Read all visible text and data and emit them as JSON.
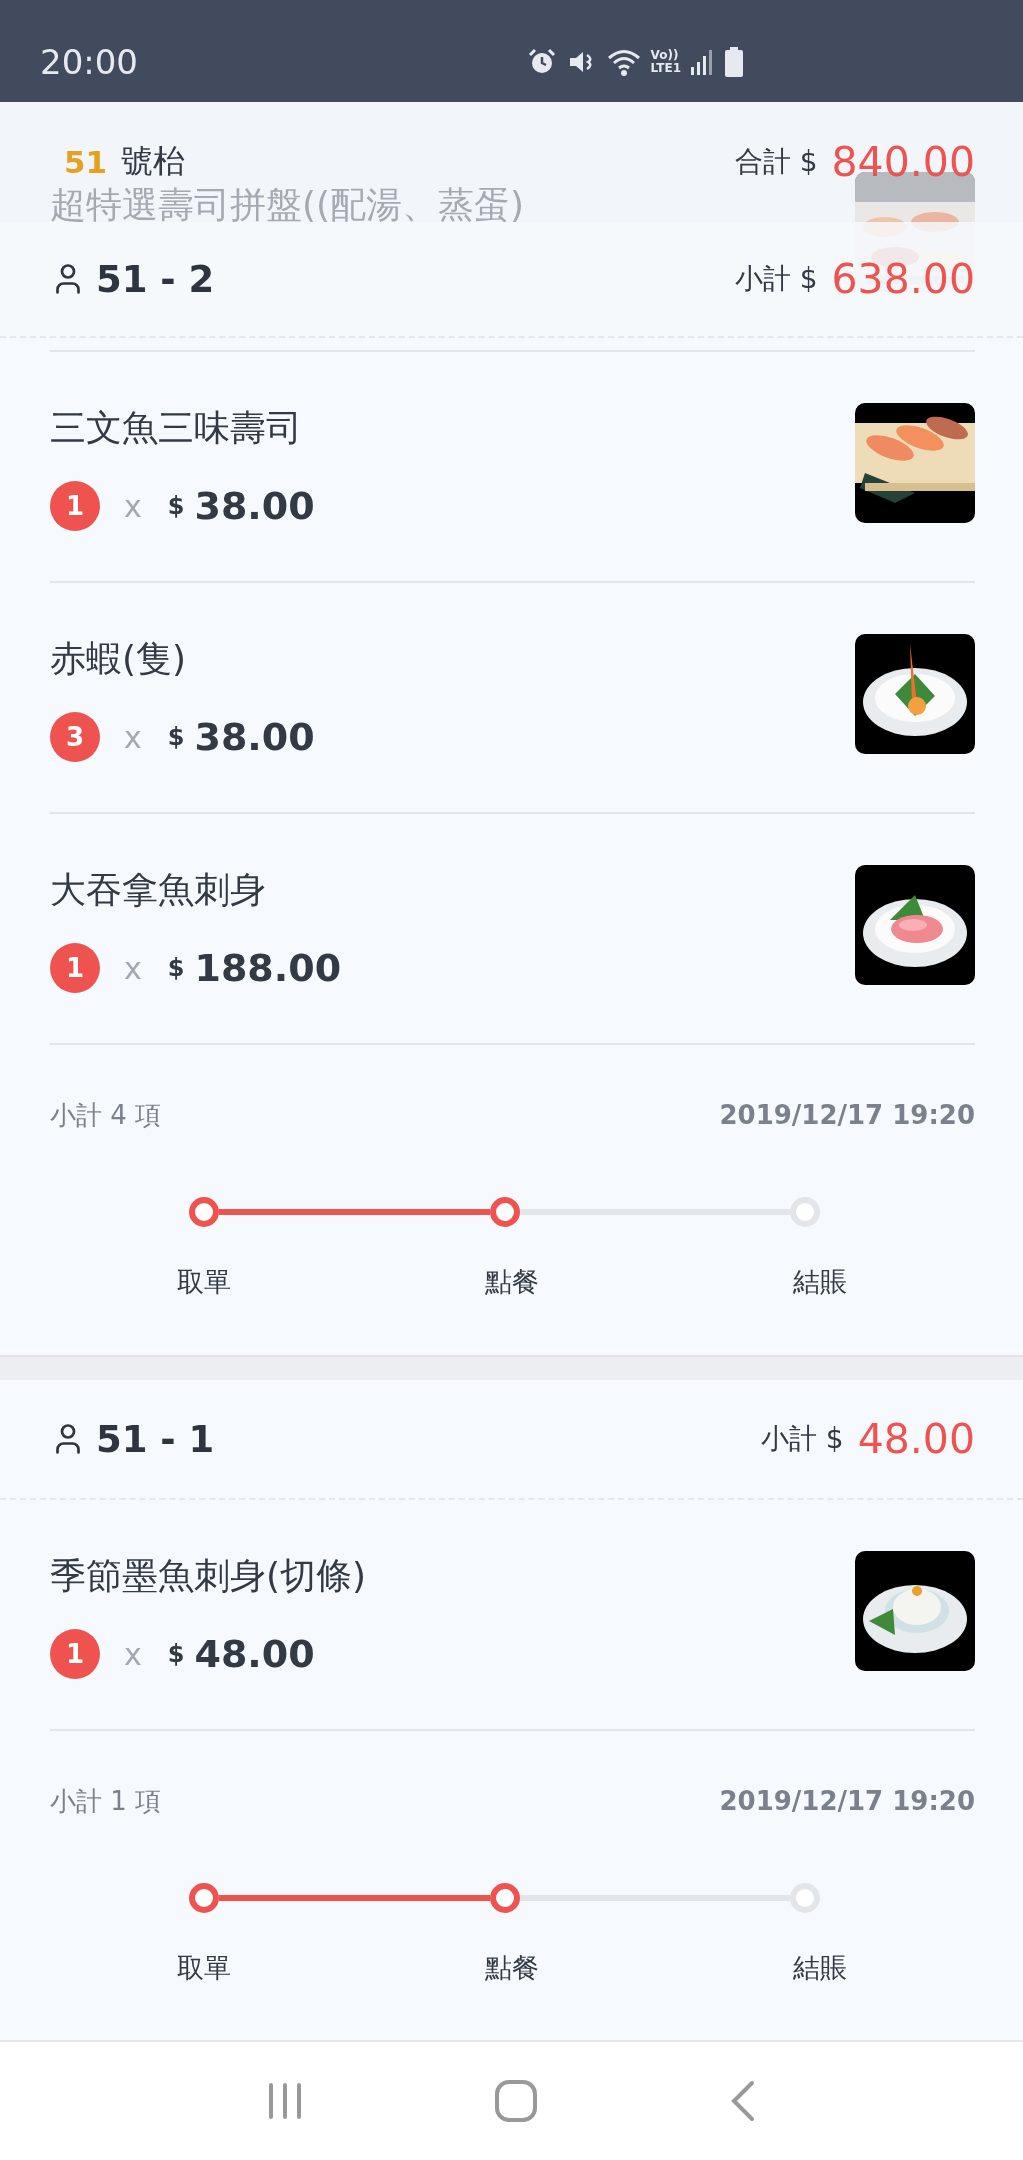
{
  "status_bar": {
    "time": "20:00",
    "volte": "Vo))",
    "network": "LTE1"
  },
  "table": {
    "number": "51",
    "label": "號枱",
    "total_label": "合計 $",
    "total": "840.00"
  },
  "groups": [
    {
      "name": "51 - 2",
      "subtotal_label": "小計 $",
      "subtotal": "638.00",
      "scrolled_item": {
        "name": "超特選壽司拼盤((配湯、蒸蛋)"
      },
      "items": [
        {
          "name": "三文魚三味壽司",
          "qty": "1",
          "times": "x",
          "currency": "$",
          "price": "38.00"
        },
        {
          "name": "赤蝦(隻)",
          "qty": "3",
          "times": "x",
          "currency": "$",
          "price": "38.00"
        },
        {
          "name": "大吞拿魚刺身",
          "qty": "1",
          "times": "x",
          "currency": "$",
          "price": "188.00"
        }
      ],
      "count_label": "小計 4 項",
      "time": "2019/12/17 19:20",
      "steps": [
        {
          "label": "取單",
          "completed": true
        },
        {
          "label": "點餐",
          "completed": true
        },
        {
          "label": "結賬",
          "completed": false
        }
      ]
    },
    {
      "name": "51 - 1",
      "subtotal_label": "小計 $",
      "subtotal": "48.00",
      "items": [
        {
          "name": "季節墨魚刺身(切條)",
          "qty": "1",
          "times": "x",
          "currency": "$",
          "price": "48.00"
        }
      ],
      "count_label": "小計 1 項",
      "time": "2019/12/17 19:20",
      "steps": [
        {
          "label": "取單",
          "completed": true
        },
        {
          "label": "點餐",
          "completed": true
        },
        {
          "label": "結賬",
          "completed": false
        }
      ]
    }
  ]
}
